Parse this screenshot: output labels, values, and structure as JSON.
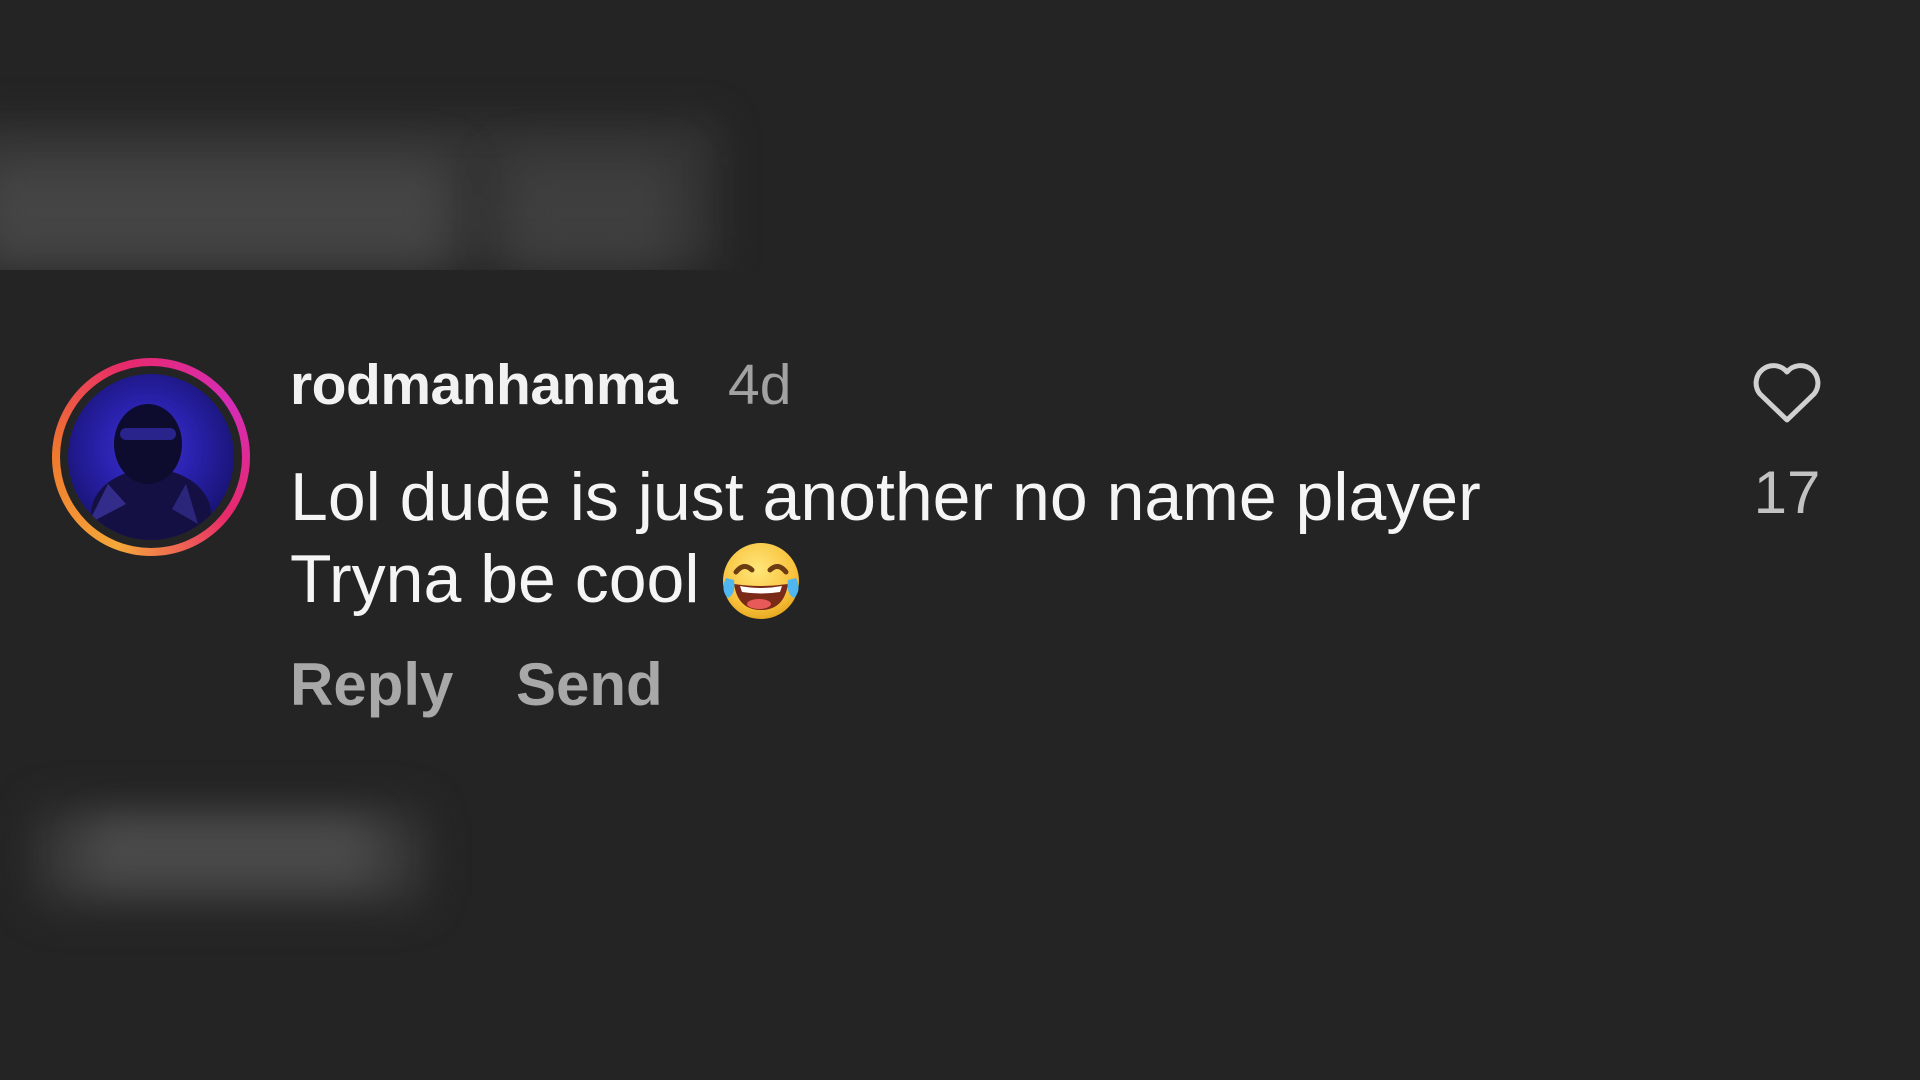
{
  "comment": {
    "username": "rodmanhanma",
    "timestamp": "4d",
    "text_line1": "Lol dude is just another no name player",
    "text_line2": "Tryna be cool",
    "emoji": "face-with-tears-of-joy",
    "like_count": "17",
    "reply_label": "Reply",
    "send_label": "Send"
  },
  "icons": {
    "like": "heart-outline-icon",
    "avatar": "story-ring-avatar"
  },
  "colors": {
    "background": "#242424",
    "username": "#f2f2f2",
    "secondary_text": "#a2a2a2",
    "story_ring": [
      "#f5a83a",
      "#e8296a",
      "#d52cb8"
    ]
  }
}
